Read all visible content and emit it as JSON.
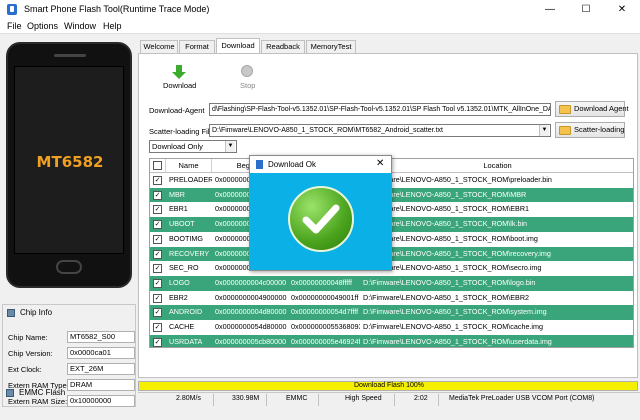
{
  "window": {
    "title": "Smart Phone Flash Tool(Runtime Trace Mode)",
    "minimize": "—",
    "maximize": "☐",
    "close": "✕"
  },
  "menu": [
    "File",
    "Options",
    "Window",
    "Help"
  ],
  "phone": {
    "chip_label": "MT6582"
  },
  "chip_info": {
    "title": "Chip Info",
    "rows": [
      {
        "label": "Chip Name:",
        "value": "MT6582_S00"
      },
      {
        "label": "Chip Version:",
        "value": "0x0000ca01"
      },
      {
        "label": "Ext Clock:",
        "value": "EXT_26M"
      },
      {
        "label": "Extern RAM Type:",
        "value": "DRAM"
      },
      {
        "label": "Extern RAM Size:",
        "value": "0x10000000"
      }
    ]
  },
  "emmc_flash": {
    "label": "EMMC Flash"
  },
  "tabs": [
    "Welcome",
    "Format",
    "Download",
    "Readback",
    "MemoryTest"
  ],
  "active_tab": "Download",
  "toolbar": {
    "download_label": "Download",
    "stop_label": "Stop"
  },
  "download_agent": {
    "label": "Download-Agent",
    "path": "d\\Flashing\\SP-Flash-Tool-v5.1352.01\\SP-Flash-Tool-v5.1352.01\\SP Flash Tool v5.1352.01\\MTK_AllInOne_DA.bin",
    "button": "Download Agent"
  },
  "scatter": {
    "label": "Scatter-loading File",
    "path": "D:\\Fimware\\LENOVO-A850_1_STOCK_ROM\\MT6582_Android_scatter.txt",
    "button": "Scatter-loading"
  },
  "mode": {
    "value": "Download Only"
  },
  "table": {
    "headers": [
      "",
      "Name",
      "Begin A",
      "",
      "Location"
    ],
    "rows": [
      {
        "checked": true,
        "name": "PRELOADER",
        "begin": "0x0000000",
        "end": "",
        "location": "D:\\Fimware\\LENOVO-A850_1_STOCK_ROM\\preloader.bin"
      },
      {
        "checked": true,
        "name": "MBR",
        "begin": "0x0000000",
        "end": "",
        "location": "D:\\Fimware\\LENOVO-A850_1_STOCK_ROM\\MBR"
      },
      {
        "checked": true,
        "name": "EBR1",
        "begin": "0x0000000",
        "end": "",
        "location": "D:\\Fimware\\LENOVO-A850_1_STOCK_ROM\\EBR1"
      },
      {
        "checked": true,
        "name": "UBOOT",
        "begin": "0x0000000",
        "end": "",
        "location": "D:\\Fimware\\LENOVO-A850_1_STOCK_ROM\\lk.bin"
      },
      {
        "checked": true,
        "name": "BOOTIMG",
        "begin": "0x0000000",
        "end": "",
        "location": "D:\\Fimware\\LENOVO-A850_1_STOCK_ROM\\boot.img"
      },
      {
        "checked": true,
        "name": "RECOVERY",
        "begin": "0x0000000",
        "end": "",
        "location": "D:\\Fimware\\LENOVO-A850_1_STOCK_ROM\\recovery.img"
      },
      {
        "checked": true,
        "name": "SEC_RO",
        "begin": "0x0000000004600000",
        "end": "",
        "location": "D:\\Fimware\\LENOVO-A850_1_STOCK_ROM\\secro.img"
      },
      {
        "checked": true,
        "name": "LOGO",
        "begin": "0x0000000004c00000",
        "end": "0x00000000048fffff",
        "location": "D:\\Fimware\\LENOVO-A850_1_STOCK_ROM\\logo.bin"
      },
      {
        "checked": true,
        "name": "EBR2",
        "begin": "0x0000000004900000",
        "end": "0x00000000049001ff",
        "location": "D:\\Fimware\\LENOVO-A850_1_STOCK_ROM\\EBR2"
      },
      {
        "checked": true,
        "name": "ANDROID",
        "begin": "0x0000000004d80000",
        "end": "0x00000000054d7ffff",
        "location": "D:\\Fimware\\LENOVO-A850_1_STOCK_ROM\\system.img"
      },
      {
        "checked": true,
        "name": "CACHE",
        "begin": "0x0000000054d80000",
        "end": "0x0000000055368093",
        "location": "D:\\Fimware\\LENOVO-A850_1_STOCK_ROM\\cache.img"
      },
      {
        "checked": true,
        "name": "USRDATA",
        "begin": "0x000000005cb80000",
        "end": "0x000000005e46924f",
        "location": "D:\\Fimware\\LENOVO-A850_1_STOCK_ROM\\userdata.img"
      }
    ]
  },
  "dialog": {
    "title": "Download Ok",
    "close": "✕"
  },
  "progress": {
    "text": "Download Flash 100%",
    "percent": 100,
    "color": "#f5f000"
  },
  "status": {
    "speed": "2.80M/s",
    "size": "330.98M",
    "storage": "EMMC",
    "usb_speed": "High Speed",
    "time": "2:02",
    "port": "MediaTek PreLoader USB VCOM Port (COM8)"
  },
  "colors": {
    "row_green": "#3aa57a",
    "dialog_bg": "#0bb0e6",
    "accent": "#2a6fc9"
  }
}
